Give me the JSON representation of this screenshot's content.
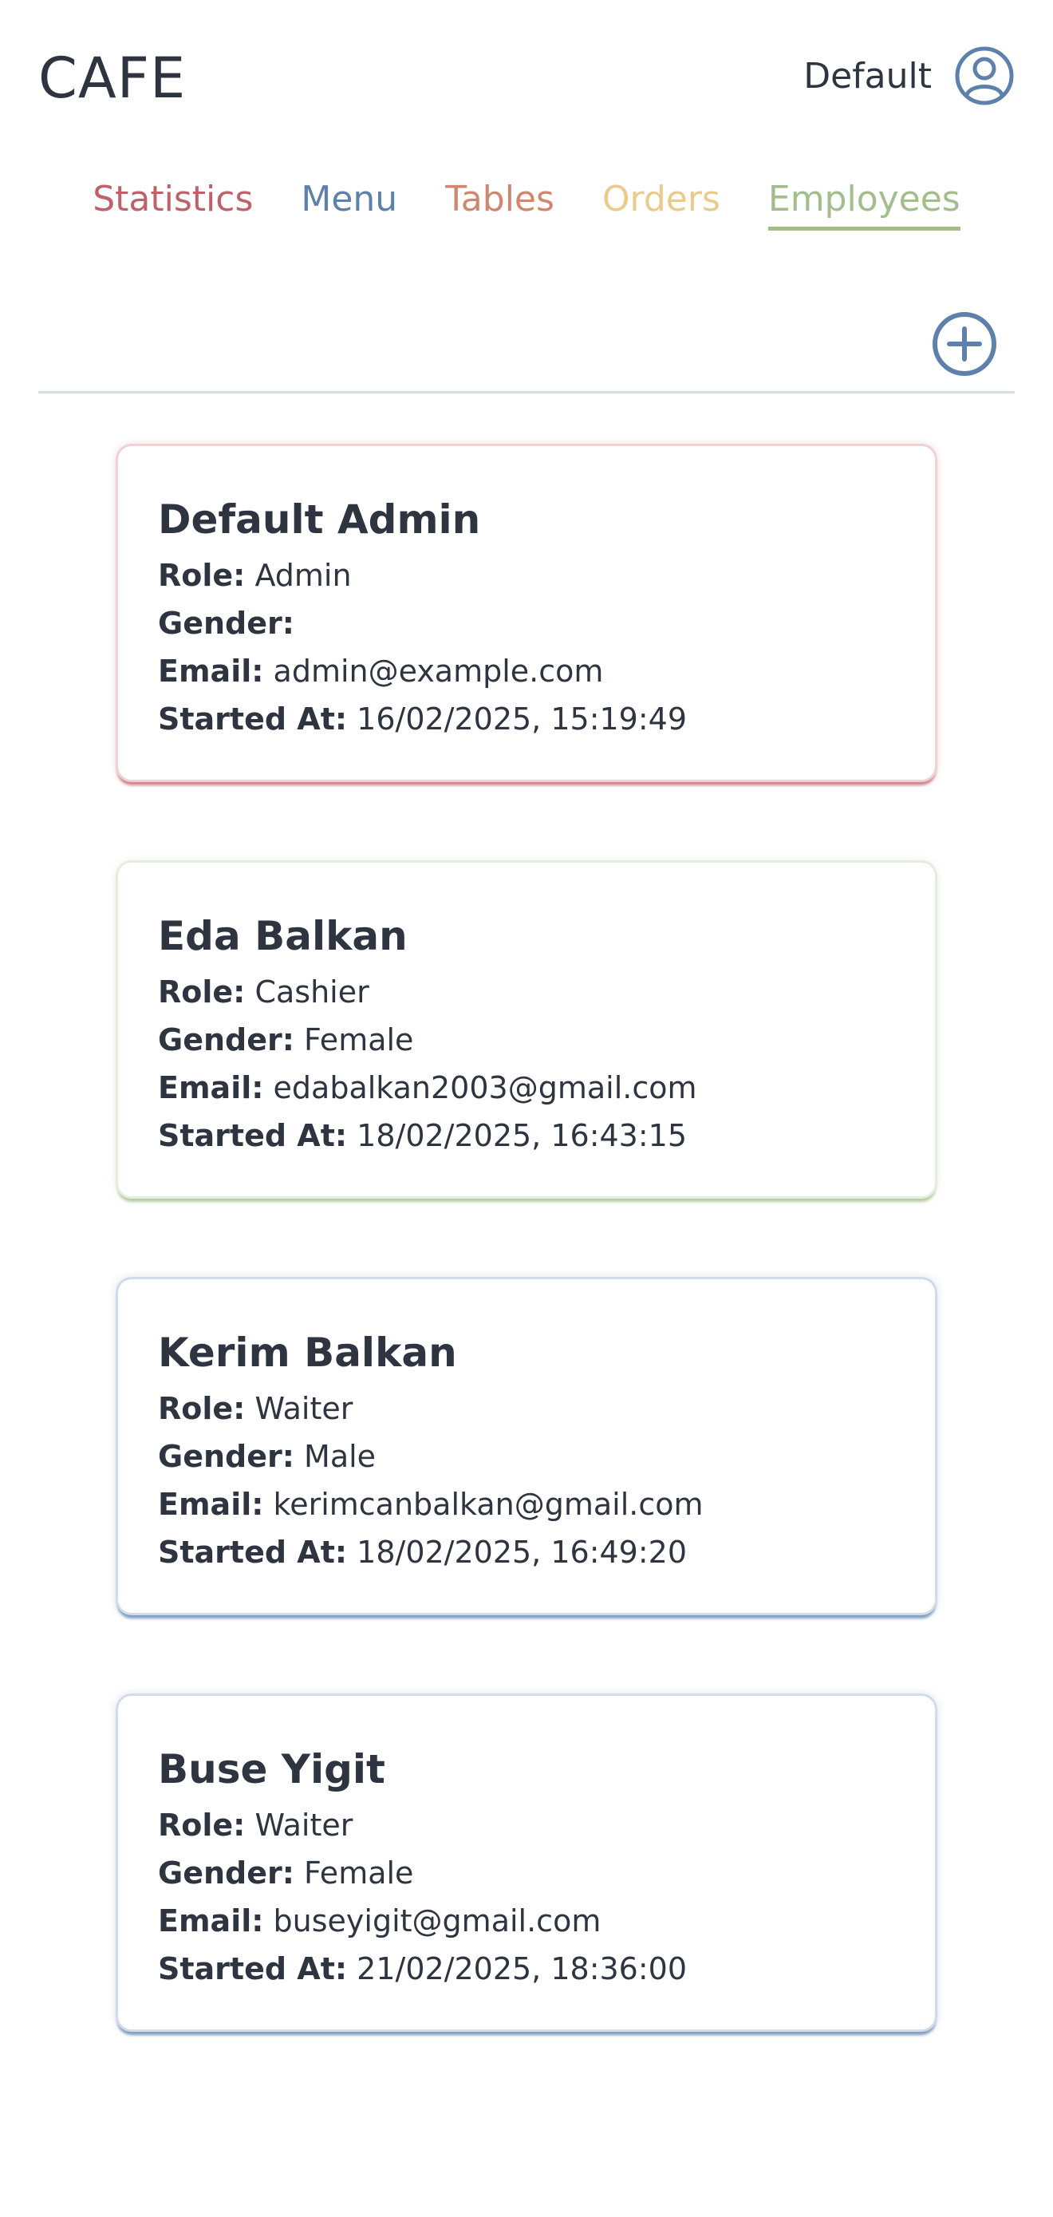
{
  "app": {
    "title": "CAFE"
  },
  "user": {
    "name": "Default",
    "icon": "user-circle-icon"
  },
  "nav": {
    "items": [
      {
        "label": "Statistics",
        "color": "#bf616a",
        "active": false
      },
      {
        "label": "Menu",
        "color": "#5e81ac",
        "active": false
      },
      {
        "label": "Tables",
        "color": "#d08770",
        "active": false
      },
      {
        "label": "Orders",
        "color": "#ebcb8b",
        "active": false
      },
      {
        "label": "Employees",
        "color": "#a3be8c",
        "active": true
      }
    ]
  },
  "toolbar": {
    "add_icon": "plus-circle-icon",
    "add_color": "#5e81ac"
  },
  "labels": {
    "role": "Role:",
    "gender": "Gender:",
    "email": "Email:",
    "started": "Started At:"
  },
  "employees": [
    {
      "name": "Default Admin",
      "role": "Admin",
      "gender": "",
      "email": "admin@example.com",
      "started_at": "16/02/2025, 15:19:49",
      "accent": "#bf616a"
    },
    {
      "name": "Eda Balkan",
      "role": "Cashier",
      "gender": "Female",
      "email": "edabalkan2003@gmail.com",
      "started_at": "18/02/2025, 16:43:15",
      "accent": "#a3be8c"
    },
    {
      "name": "Kerim Balkan",
      "role": "Waiter",
      "gender": "Male",
      "email": "kerimcanbalkan@gmail.com",
      "started_at": "18/02/2025, 16:49:20",
      "accent": "#5e81ac"
    },
    {
      "name": "Buse Yigit",
      "role": "Waiter",
      "gender": "Female",
      "email": "buseyigit@gmail.com",
      "started_at": "21/02/2025, 18:36:00",
      "accent": "#5e81ac"
    }
  ]
}
